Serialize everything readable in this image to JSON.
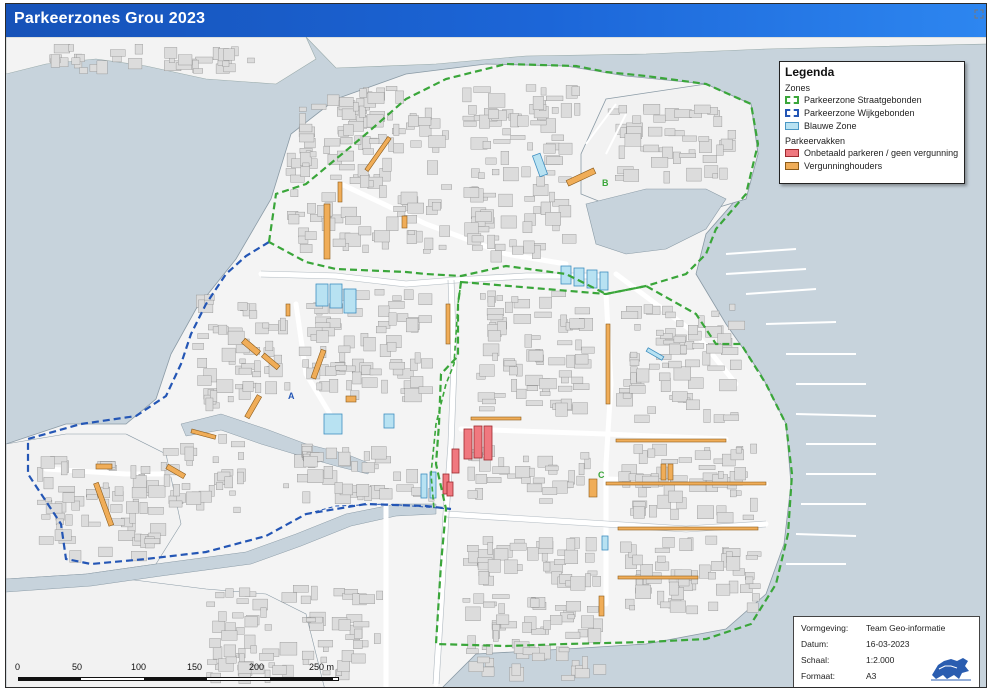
{
  "title": "Parkeerzones Grou 2023",
  "legend": {
    "title": "Legenda",
    "sections": [
      {
        "header": "Zones",
        "items": [
          {
            "label": "Parkeerzone Straatgebonden",
            "swatch": "green-dashed",
            "color": "#3aa63a"
          },
          {
            "label": "Parkeerzone Wijkgebonden",
            "swatch": "blue-dashed",
            "color": "#2456b5"
          },
          {
            "label": "Blauwe Zone",
            "swatch": "light-blue-fill",
            "color": "#b8e2f2"
          }
        ]
      },
      {
        "header": "Parkeervakken",
        "items": [
          {
            "label": "Onbetaald parkeren / geen vergunning",
            "swatch": "red-fill",
            "color": "#f0787f"
          },
          {
            "label": "Vergunninghouders",
            "swatch": "orange-fill",
            "color": "#f0ad58"
          }
        ]
      }
    ]
  },
  "zone_labels": {
    "a": "A",
    "b": "B",
    "c": "C"
  },
  "info": {
    "rows": [
      {
        "key": "Vormgeving:",
        "value": "Team Geo-informatie"
      },
      {
        "key": "Datum:",
        "value": "16-03-2023"
      },
      {
        "key": "Schaal:",
        "value": "1:2.000"
      },
      {
        "key": "Formaat:",
        "value": "A3"
      }
    ]
  },
  "scale": {
    "ticks": [
      "0",
      "50",
      "100",
      "150",
      "200",
      "250 m"
    ]
  },
  "colors": {
    "water": "#c7d3dc",
    "land": "#f4f4f4",
    "building": "#dcdcdc",
    "green_zone": "#3aa63a",
    "blue_zone": "#2456b5",
    "blue_parking": "#b8e2f2",
    "red_parking": "#f0787f",
    "orange_parking": "#f0ad58"
  },
  "icons": {
    "logo": "lion-emblem-icon",
    "corner": "expand-icon"
  }
}
